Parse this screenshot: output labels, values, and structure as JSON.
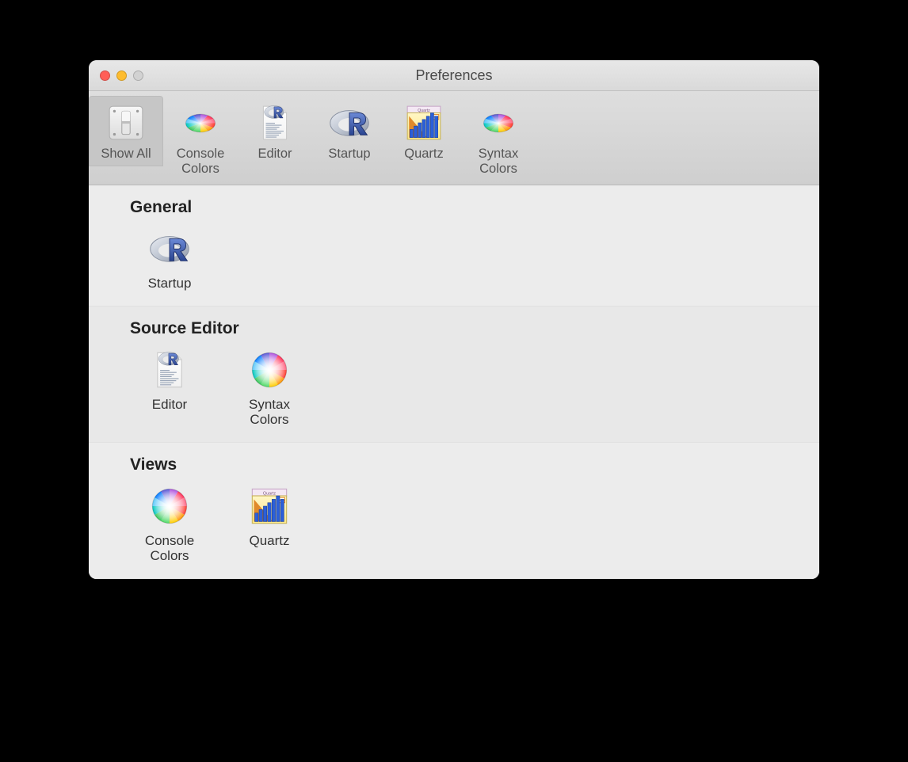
{
  "window": {
    "title": "Preferences"
  },
  "toolbar": {
    "items": [
      {
        "icon": "switch-icon",
        "label": "Show All",
        "selected": true
      },
      {
        "icon": "color-oval-icon",
        "label": "Console\nColors"
      },
      {
        "icon": "document-r-icon",
        "label": "Editor"
      },
      {
        "icon": "r-logo-icon",
        "label": "Startup"
      },
      {
        "icon": "quartz-chart-icon",
        "label": "Quartz"
      },
      {
        "icon": "color-oval-icon",
        "label": "Syntax\nColors"
      }
    ]
  },
  "sections": [
    {
      "title": "General",
      "items": [
        {
          "icon": "r-logo-icon",
          "label": "Startup"
        }
      ]
    },
    {
      "title": "Source Editor",
      "items": [
        {
          "icon": "document-r-icon",
          "label": "Editor"
        },
        {
          "icon": "color-wheel-icon",
          "label": "Syntax\nColors"
        }
      ]
    },
    {
      "title": "Views",
      "items": [
        {
          "icon": "color-wheel-icon",
          "label": "Console\nColors"
        },
        {
          "icon": "quartz-chart-icon",
          "label": "Quartz"
        }
      ]
    }
  ]
}
